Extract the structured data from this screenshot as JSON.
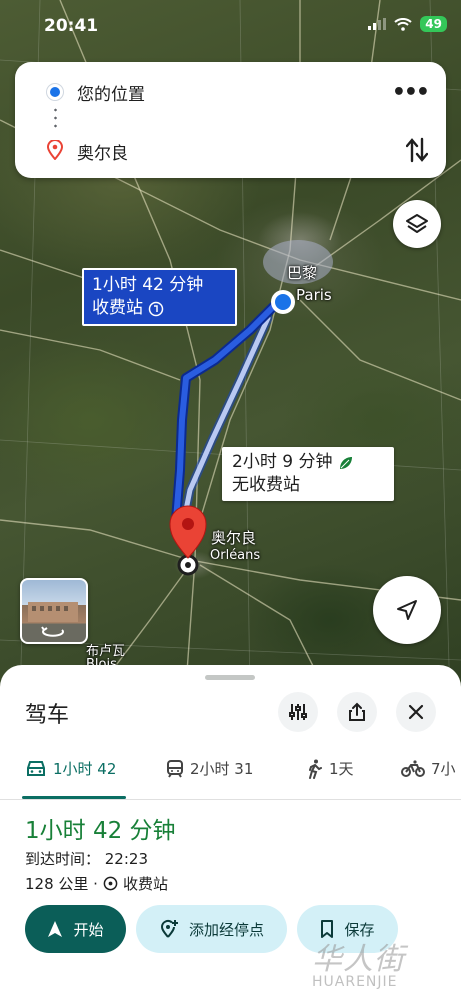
{
  "status": {
    "time": "20:41",
    "battery": "49"
  },
  "directions": {
    "origin": "您的位置",
    "destination": "奥尔良"
  },
  "map": {
    "city_paris_cn": "巴黎",
    "city_paris_en": "Paris",
    "city_orleans_cn": "奥尔良",
    "city_orleans_en": "Orléans",
    "city_blois_cn": "布卢瓦",
    "city_blois_en": "Blois",
    "route_main": {
      "line1": "1小时 42 分钟",
      "line2": "收费站"
    },
    "route_alt": {
      "line1": "2小时 9 分钟",
      "line2": "无收费站"
    }
  },
  "sheet": {
    "title": "驾车",
    "modes": [
      {
        "icon": "car-icon",
        "label": "1小时 42"
      },
      {
        "icon": "train-icon",
        "label": "2小时 31"
      },
      {
        "icon": "walk-icon",
        "label": "1天"
      },
      {
        "icon": "bike-icon",
        "label": "7小"
      }
    ],
    "duration": "1小时 42 分钟",
    "arrival": "到达时间： 22:23",
    "distance": "128 公里 ·",
    "toll": "收费站",
    "actions": {
      "start": "开始",
      "add_stop": "添加经停点",
      "save": "保存"
    }
  },
  "watermark": {
    "logo": "华人街",
    "text": "HUARENJIE"
  },
  "colors": {
    "route": "#1a46c2",
    "active": "#0b6e63",
    "duration": "#188038"
  }
}
